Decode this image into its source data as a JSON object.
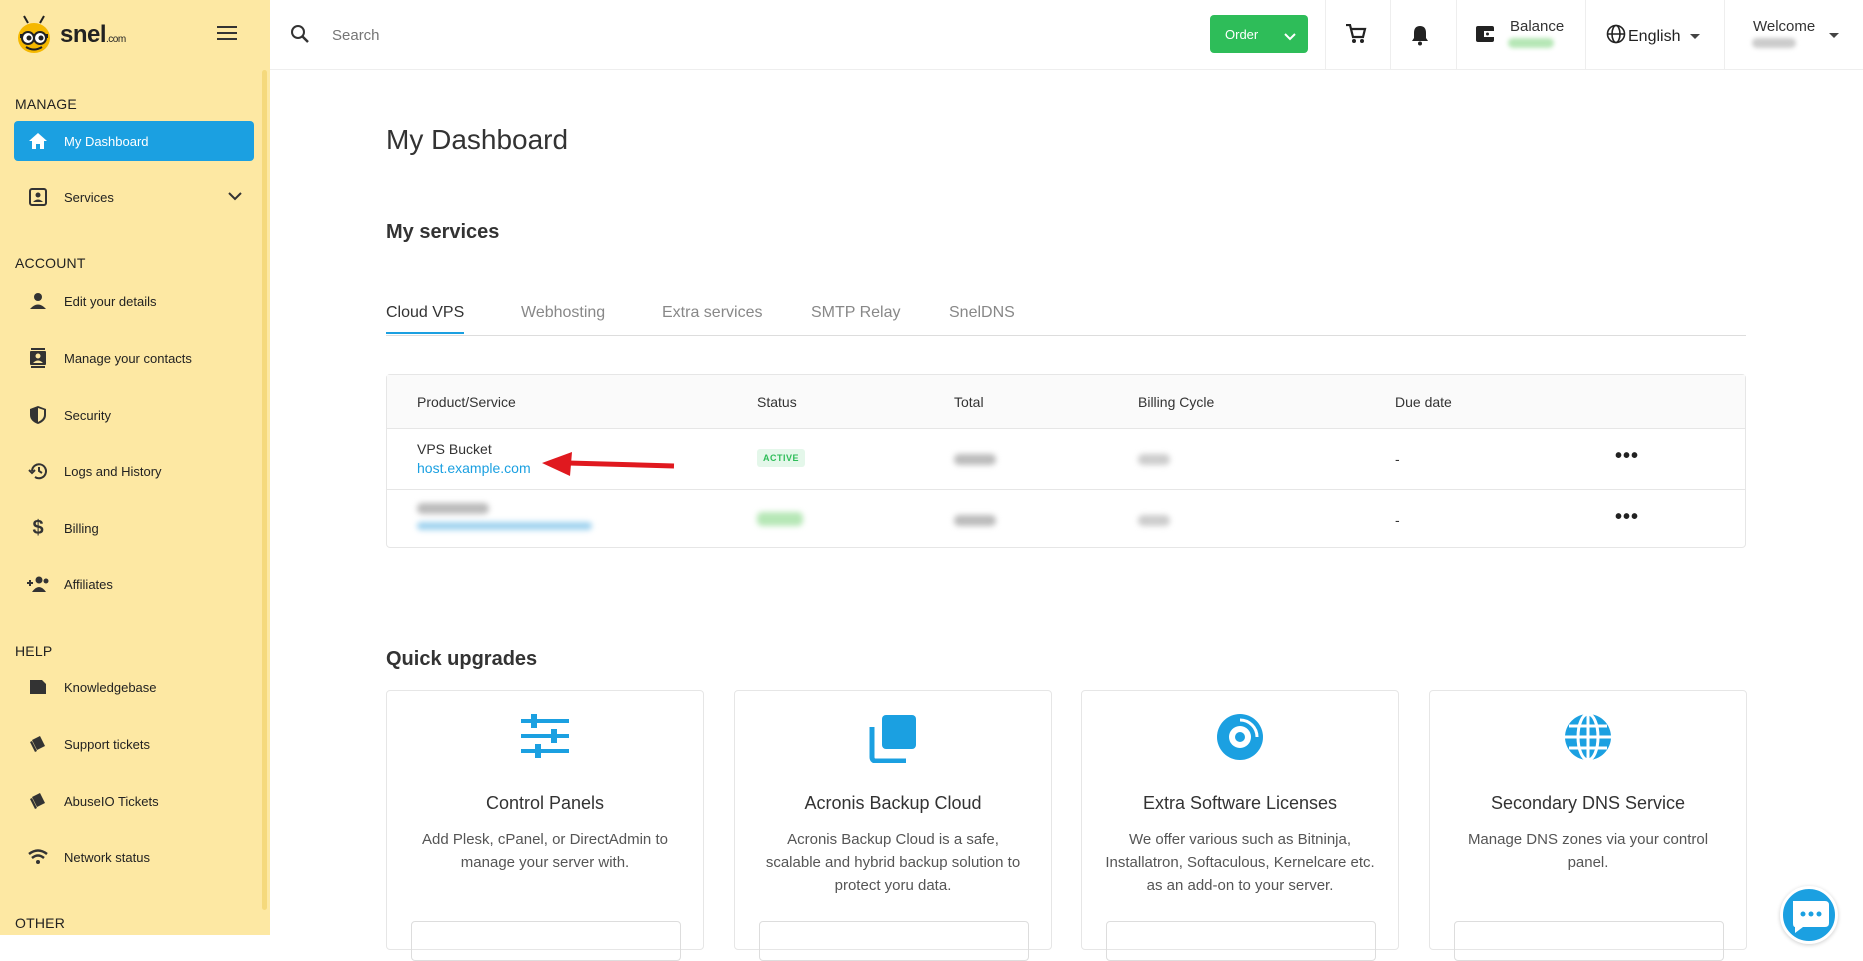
{
  "brand": {
    "name": "snel",
    "suffix": ".com"
  },
  "sidebar": {
    "sections": {
      "manage": "MANAGE",
      "account": "ACCOUNT",
      "help": "HELP",
      "other": "OTHER"
    },
    "items": [
      {
        "label": "My Dashboard",
        "icon": "home-icon",
        "active": true
      },
      {
        "label": "Services",
        "icon": "services-icon"
      },
      {
        "label": "Edit your details",
        "icon": "person-icon"
      },
      {
        "label": "Manage your contacts",
        "icon": "contacts-icon"
      },
      {
        "label": "Security",
        "icon": "shield-icon"
      },
      {
        "label": "Logs and History",
        "icon": "history-icon"
      },
      {
        "label": "Billing",
        "icon": "dollar-icon"
      },
      {
        "label": "Affiliates",
        "icon": "affiliates-icon"
      },
      {
        "label": "Knowledgebase",
        "icon": "book-icon"
      },
      {
        "label": "Support tickets",
        "icon": "ticket-icon"
      },
      {
        "label": "AbuseIO Tickets",
        "icon": "ticket-icon"
      },
      {
        "label": "Network status",
        "icon": "wifi-icon"
      }
    ]
  },
  "topbar": {
    "search_placeholder": "Search",
    "order_label": "Order",
    "balance_label": "Balance",
    "language": "English",
    "welcome_label": "Welcome"
  },
  "main": {
    "title": "My Dashboard",
    "services_heading": "My services",
    "tabs": [
      "Cloud VPS",
      "Webhosting",
      "Extra services",
      "SMTP Relay",
      "SnelDNS"
    ],
    "table": {
      "headers": [
        "Product/Service",
        "Status",
        "Total",
        "Billing Cycle",
        "Due date"
      ],
      "rows": [
        {
          "product": "VPS Bucket",
          "host": "host.example.com",
          "status": "ACTIVE",
          "due": "-"
        },
        {
          "due": "-"
        }
      ]
    },
    "upgrades_heading": "Quick upgrades",
    "cards": [
      {
        "title": "Control Panels",
        "desc": "Add Plesk, cPanel, or DirectAdmin to manage your server with.",
        "icon": "sliders-icon"
      },
      {
        "title": "Acronis Backup Cloud",
        "desc": "Acronis Backup Cloud is a safe, scalable and hybrid backup solution to protect yoru data.",
        "icon": "copy-icon"
      },
      {
        "title": "Extra Software Licenses",
        "desc": "We offer various such as Bitninja, Installatron, Softaculous, Kernelcare etc. as an add-on to your server.",
        "icon": "disc-icon"
      },
      {
        "title": "Secondary DNS Service",
        "desc": "Manage DNS zones via your control panel.",
        "icon": "globe-icon"
      }
    ]
  },
  "colors": {
    "sidebar_bg": "#fde8a3",
    "accent": "#1ba0e1",
    "success": "#2ebd59"
  }
}
